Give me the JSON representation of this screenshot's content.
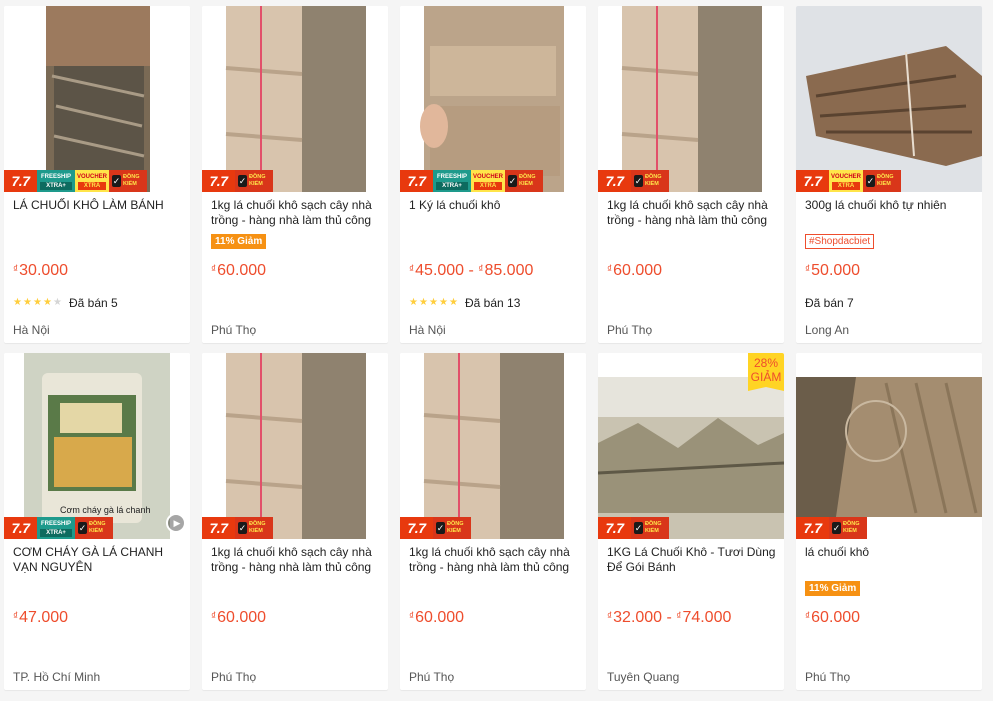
{
  "icons": {
    "star": "star-icon",
    "play": "play-icon",
    "check": "check-icon"
  },
  "colors": {
    "price": "#ee4d2d",
    "badge_77": "#e8390e",
    "freeship": "#1e9a8c",
    "voucher": "#ffe54a",
    "sale_tag": "#f69113"
  },
  "badges": {
    "sale77": "7.7",
    "freeship_top": "FREESHIP",
    "freeship_bottom": "XTRA+",
    "voucher_top": "VOUCHER",
    "voucher_bottom": "XTRA",
    "dongkiem": "ĐỒNG KIỂM",
    "check": "✓"
  },
  "products": [
    {
      "title": "LÁ CHUỐI KHÔ LÀM BÁNH",
      "currency": "₫",
      "price": "30.000",
      "price_max": "",
      "sale_tag": "",
      "shop_tag": "",
      "rating": 3.5,
      "sold": "Đã bán 5",
      "location": "Hà Nội",
      "discount": "",
      "freeship": true,
      "voucher": true,
      "video": false
    },
    {
      "title": "1kg lá chuối khô sạch cây nhà trồng - hàng nhà làm thủ công",
      "currency": "₫",
      "price": "60.000",
      "price_max": "",
      "sale_tag": "11% Giảm",
      "shop_tag": "",
      "rating": 0,
      "sold": "",
      "location": "Phú Thọ",
      "discount": "",
      "freeship": false,
      "voucher": false,
      "video": false
    },
    {
      "title": "1 Ký lá chuối khô",
      "currency": "₫",
      "price": "45.000",
      "price_max": "85.000",
      "sale_tag": "",
      "shop_tag": "",
      "rating": 5,
      "sold": "Đã bán 13",
      "location": "Hà Nội",
      "discount": "",
      "freeship": true,
      "voucher": true,
      "video": false
    },
    {
      "title": "1kg lá chuối khô sạch cây nhà trồng - hàng nhà làm thủ công",
      "currency": "₫",
      "price": "60.000",
      "price_max": "",
      "sale_tag": "",
      "shop_tag": "",
      "rating": 0,
      "sold": "",
      "location": "Phú Thọ",
      "discount": "",
      "freeship": false,
      "voucher": false,
      "video": false
    },
    {
      "title": "300g lá chuối khô tự nhiên",
      "currency": "₫",
      "price": "50.000",
      "price_max": "",
      "sale_tag": "",
      "shop_tag": "#Shopdacbiet",
      "rating": 0,
      "sold": "Đã bán 7",
      "location": "Long An",
      "discount": "",
      "freeship": false,
      "voucher": true,
      "video": false
    },
    {
      "title": "CƠM CHÁY GÀ LÁ CHANH VẠN NGUYÊN",
      "currency": "₫",
      "price": "47.000",
      "price_max": "",
      "sale_tag": "",
      "shop_tag": "",
      "rating": 0,
      "sold": "",
      "location": "TP. Hồ Chí Minh",
      "discount": "",
      "freeship": true,
      "voucher": false,
      "video": true,
      "overlay_text": "Cơm cháy gà lá chanh"
    },
    {
      "title": "1kg lá chuối khô sạch cây nhà trồng - hàng nhà làm thủ công",
      "currency": "₫",
      "price": "60.000",
      "price_max": "",
      "sale_tag": "",
      "shop_tag": "",
      "rating": 0,
      "sold": "",
      "location": "Phú Thọ",
      "discount": "",
      "freeship": false,
      "voucher": false,
      "video": false
    },
    {
      "title": "1kg lá chuối khô sạch cây nhà trồng - hàng nhà làm thủ công",
      "currency": "₫",
      "price": "60.000",
      "price_max": "",
      "sale_tag": "",
      "shop_tag": "",
      "rating": 0,
      "sold": "",
      "location": "Phú Thọ",
      "discount": "",
      "freeship": false,
      "voucher": false,
      "video": false
    },
    {
      "title": "1KG Lá Chuối Khô - Tươi Dùng Để Gói Bánh",
      "currency": "₫",
      "price": "32.000",
      "price_max": "74.000",
      "sale_tag": "",
      "shop_tag": "",
      "rating": 0,
      "sold": "",
      "location": "Tuyên Quang",
      "discount": "28% GIẢM",
      "freeship": false,
      "voucher": false,
      "video": false
    },
    {
      "title": "lá chuối khô",
      "currency": "₫",
      "price": "60.000",
      "price_max": "",
      "sale_tag": "11% Giảm",
      "shop_tag": "",
      "rating": 0,
      "sold": "",
      "location": "Phú Thọ",
      "discount": "",
      "freeship": false,
      "voucher": false,
      "video": false
    }
  ]
}
